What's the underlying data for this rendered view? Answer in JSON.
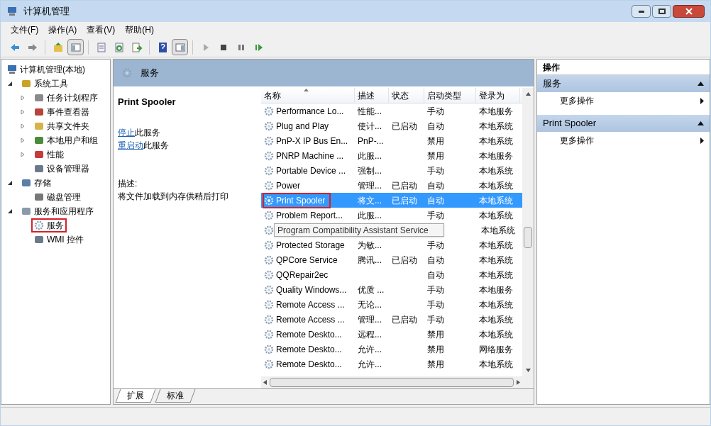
{
  "window": {
    "title": "计算机管理"
  },
  "menu": [
    "文件(F)",
    "操作(A)",
    "查看(V)",
    "帮助(H)"
  ],
  "toolbar": [
    {
      "kind": "back"
    },
    {
      "kind": "forward"
    },
    {
      "kind": "sep"
    },
    {
      "kind": "up"
    },
    {
      "kind": "tree",
      "pressed": true
    },
    {
      "kind": "sep"
    },
    {
      "kind": "properties"
    },
    {
      "kind": "refresh"
    },
    {
      "kind": "export"
    },
    {
      "kind": "sep"
    },
    {
      "kind": "help"
    },
    {
      "kind": "pane",
      "pressed": true
    },
    {
      "kind": "sep"
    },
    {
      "kind": "play"
    },
    {
      "kind": "stop"
    },
    {
      "kind": "pause"
    },
    {
      "kind": "resume"
    }
  ],
  "tree": [
    {
      "label": "计算机管理(本地)",
      "children": [
        {
          "label": "系统工具",
          "expanded": true,
          "children": [
            {
              "label": "任务计划程序",
              "expanded": false
            },
            {
              "label": "事件查看器",
              "expanded": false
            },
            {
              "label": "共享文件夹",
              "expanded": false
            },
            {
              "label": "本地用户和组",
              "expanded": false
            },
            {
              "label": "性能",
              "expanded": false
            },
            {
              "label": "设备管理器"
            }
          ]
        },
        {
          "label": "存储",
          "expanded": true,
          "children": [
            {
              "label": "磁盘管理"
            }
          ]
        },
        {
          "label": "服务和应用程序",
          "expanded": true,
          "children": [
            {
              "label": "服务",
              "highlighted": true
            },
            {
              "label": "WMI 控件"
            }
          ]
        }
      ]
    }
  ],
  "header": {
    "title": "服务"
  },
  "details": {
    "name": "Print Spooler",
    "links": [
      {
        "link": "停止",
        "text": "此服务"
      },
      {
        "link": "重启动",
        "text": "此服务"
      }
    ],
    "desc_label": "描述:",
    "description": "将文件加载到内存供稍后打印"
  },
  "table": {
    "columns": [
      {
        "label": "名称",
        "sorted": true
      },
      {
        "label": "描述"
      },
      {
        "label": "状态"
      },
      {
        "label": "启动类型"
      },
      {
        "label": "登录为"
      }
    ],
    "rows": [
      {
        "name": "Performance Lo...",
        "desc": "性能...",
        "startup": "手动",
        "logon": "本地服务",
        "selected": false
      },
      {
        "name": "Plug and Play",
        "desc": "使计...",
        "status": "已启动",
        "startup": "自动",
        "logon": "本地系统",
        "selected": false
      },
      {
        "name": "PnP-X IP Bus En...",
        "desc": "PnP-...",
        "startup": "禁用",
        "logon": "本地系统",
        "selected": false
      },
      {
        "name": "PNRP Machine ...",
        "desc": "此服...",
        "startup": "禁用",
        "logon": "本地服务",
        "selected": false
      },
      {
        "name": "Portable Device ...",
        "desc": "强制...",
        "startup": "手动",
        "logon": "本地系统",
        "selected": false
      },
      {
        "name": "Power",
        "desc": "管理...",
        "status": "已启动",
        "startup": "自动",
        "logon": "本地系统",
        "selected": false
      },
      {
        "name": "Print Spooler",
        "desc": "将文...",
        "status": "已启动",
        "startup": "自动",
        "logon": "本地系统",
        "selected": true,
        "highlighted": true
      },
      {
        "name": "Problem Report...",
        "desc": "此服...",
        "startup": "手动",
        "logon": "本地系统",
        "selected": false
      },
      {
        "tooltip": "Program Compatibility Assistant Service",
        "logon": "本地系统",
        "selected": false
      },
      {
        "name": "Protected Storage",
        "desc": "为敏...",
        "startup": "手动",
        "logon": "本地系统",
        "selected": false
      },
      {
        "name": "QPCore Service",
        "desc": "腾讯...",
        "status": "已启动",
        "startup": "自动",
        "logon": "本地系统",
        "selected": false
      },
      {
        "name": "QQRepair2ec",
        "startup": "自动",
        "logon": "本地系统",
        "selected": false
      },
      {
        "name": "Quality Windows...",
        "desc": "优质 ...",
        "startup": "手动",
        "logon": "本地服务",
        "selected": false
      },
      {
        "name": "Remote Access ...",
        "desc": "无论...",
        "startup": "手动",
        "logon": "本地系统",
        "selected": false
      },
      {
        "name": "Remote Access ...",
        "desc": "管理...",
        "status": "已启动",
        "startup": "手动",
        "logon": "本地系统",
        "selected": false
      },
      {
        "name": "Remote Deskto...",
        "desc": "远程...",
        "startup": "禁用",
        "logon": "本地系统",
        "selected": false
      },
      {
        "name": "Remote Deskto...",
        "desc": "允许...",
        "startup": "禁用",
        "logon": "网络服务",
        "selected": false
      },
      {
        "name": "Remote Deskto...",
        "desc": "允许...",
        "startup": "禁用",
        "logon": "本地系统",
        "selected": false
      }
    ]
  },
  "tabs": [
    {
      "label": "扩展",
      "selected": true
    },
    {
      "label": "标准",
      "selected": false
    }
  ],
  "actions": {
    "title": "操作",
    "sections": [
      {
        "title": "服务",
        "expanded": true,
        "items": [
          "更多操作"
        ]
      },
      {
        "title": "Print Spooler",
        "expanded": true,
        "items": [
          "更多操作"
        ]
      }
    ]
  }
}
